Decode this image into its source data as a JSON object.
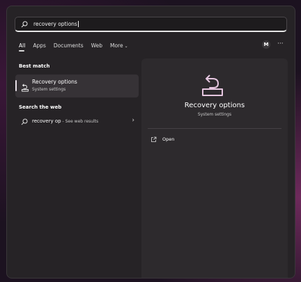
{
  "search": {
    "query": "recovery options"
  },
  "tabs": [
    {
      "label": "All",
      "active": true
    },
    {
      "label": "Apps"
    },
    {
      "label": "Documents"
    },
    {
      "label": "Web"
    },
    {
      "label": "More"
    }
  ],
  "account": {
    "initial": "M",
    "more_label": "···"
  },
  "best_match": {
    "heading": "Best match",
    "title": "Recovery options",
    "subtitle": "System settings",
    "icon": "recovery-icon"
  },
  "web": {
    "heading": "Search the web",
    "query": "recovery op",
    "suffix": " - See web results",
    "icon": "search-icon"
  },
  "detail": {
    "title": "Recovery options",
    "subtitle": "System settings",
    "actions": [
      {
        "label": "Open",
        "icon": "open-external-icon"
      }
    ]
  },
  "colors": {
    "panel": "#262326",
    "detail_panel": "#2d2a2d",
    "selected_item": "#363236",
    "text": "#ffffff"
  }
}
